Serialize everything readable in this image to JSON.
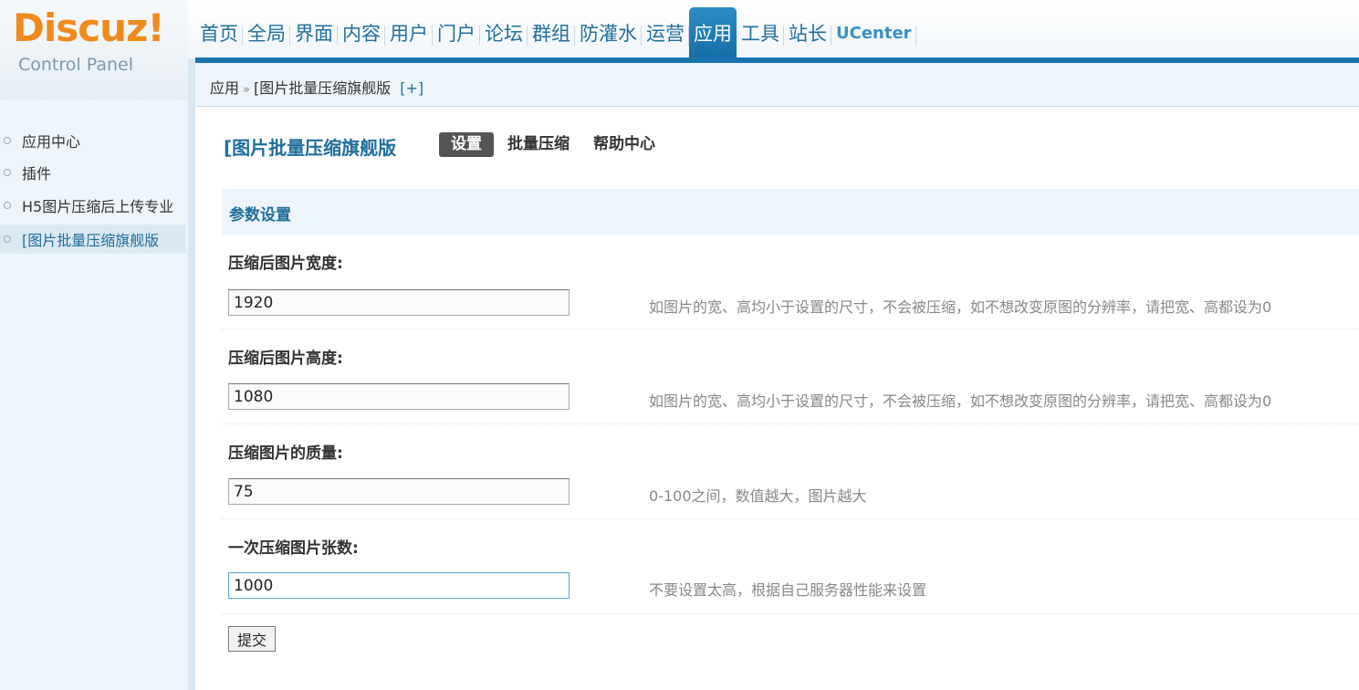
{
  "header": {
    "logo_text": "Discuz!",
    "logo_sub": "Control Panel",
    "nav": [
      {
        "label": "首页"
      },
      {
        "label": "全局"
      },
      {
        "label": "界面"
      },
      {
        "label": "内容"
      },
      {
        "label": "用户"
      },
      {
        "label": "门户"
      },
      {
        "label": "论坛"
      },
      {
        "label": "群组"
      },
      {
        "label": "防灌水"
      },
      {
        "label": "运营"
      },
      {
        "label": "应用",
        "active": true
      },
      {
        "label": "工具"
      },
      {
        "label": "站长"
      },
      {
        "label": "UCenter"
      }
    ]
  },
  "breadcrumb": {
    "root": "应用",
    "sep": "»",
    "current": "[图片批量压缩旗舰版",
    "plus": "[+]"
  },
  "sidebar": {
    "items": [
      {
        "label": "应用中心"
      },
      {
        "label": "插件"
      },
      {
        "label": "H5图片压缩后上传专业"
      },
      {
        "label": "[图片批量压缩旗舰版",
        "active": true
      }
    ]
  },
  "main": {
    "plugin_title": "[图片批量压缩旗舰版",
    "tabs": [
      {
        "label": "设置",
        "active": true
      },
      {
        "label": "批量压缩"
      },
      {
        "label": "帮助中心"
      }
    ],
    "section_title": "参数设置",
    "fields": [
      {
        "label": "压缩后图片宽度:",
        "value": "1920",
        "hint": "如图片的宽、高均小于设置的尺寸，不会被压缩，如不想改变原图的分辨率，请把宽、高都设为0"
      },
      {
        "label": "压缩后图片高度:",
        "value": "1080",
        "hint": "如图片的宽、高均小于设置的尺寸，不会被压缩，如不想改变原图的分辨率，请把宽、高都设为0"
      },
      {
        "label": "压缩图片的质量:",
        "value": "75",
        "hint": "0-100之间，数值越大，图片越大"
      },
      {
        "label": "一次压缩图片张数:",
        "value": "1000",
        "hint": "不要设置太高，根据自己服务器性能来设置"
      }
    ],
    "submit_label": "提交"
  },
  "colors": {
    "accent": "#1a73ad",
    "logo": "#f08a1c",
    "link": "#1f6f9c",
    "panel_bg": "#eef5fa"
  }
}
